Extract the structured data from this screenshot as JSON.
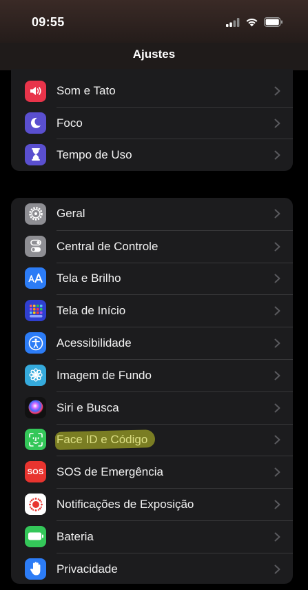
{
  "status_bar": {
    "time": "09:55"
  },
  "nav": {
    "title": "Ajustes"
  },
  "groups": [
    {
      "items": [
        {
          "label": "Som e Tato",
          "icon": "speaker-icon",
          "color": "#e8344a"
        },
        {
          "label": "Foco",
          "icon": "moon-icon",
          "color": "#5a4fcf"
        },
        {
          "label": "Tempo de Uso",
          "icon": "hourglass-icon",
          "color": "#5a4fcf"
        }
      ]
    },
    {
      "items": [
        {
          "label": "Geral",
          "icon": "gear-icon",
          "color": "#8e8e93"
        },
        {
          "label": "Central de Controle",
          "icon": "toggles-icon",
          "color": "#8e8e93"
        },
        {
          "label": "Tela e Brilho",
          "icon": "text-size-icon",
          "color": "#2c7cf6"
        },
        {
          "label": "Tela de Início",
          "icon": "app-grid-icon",
          "color": "#2f3fd0"
        },
        {
          "label": "Acessibilidade",
          "icon": "accessibility-icon",
          "color": "#2c7cf6"
        },
        {
          "label": "Imagem de Fundo",
          "icon": "flower-icon",
          "color": "#35aadc"
        },
        {
          "label": "Siri e Busca",
          "icon": "siri-icon",
          "color": "#111111"
        },
        {
          "label": "Face ID e Código",
          "icon": "face-id-icon",
          "color": "#34c759"
        },
        {
          "label": "SOS de Emergência",
          "icon": "sos-icon",
          "color": "#e8342f",
          "icon_text": "SOS"
        },
        {
          "label": "Notificações de Exposição",
          "icon": "exposure-icon",
          "color": "#ffffff"
        },
        {
          "label": "Bateria",
          "icon": "battery-icon",
          "color": "#34c759"
        },
        {
          "label": "Privacidade",
          "icon": "hand-icon",
          "color": "#2c7cf6"
        }
      ]
    }
  ],
  "annotation": {
    "highlight_color": "#c8cd28",
    "highlighted_item": "Face ID e Código"
  }
}
